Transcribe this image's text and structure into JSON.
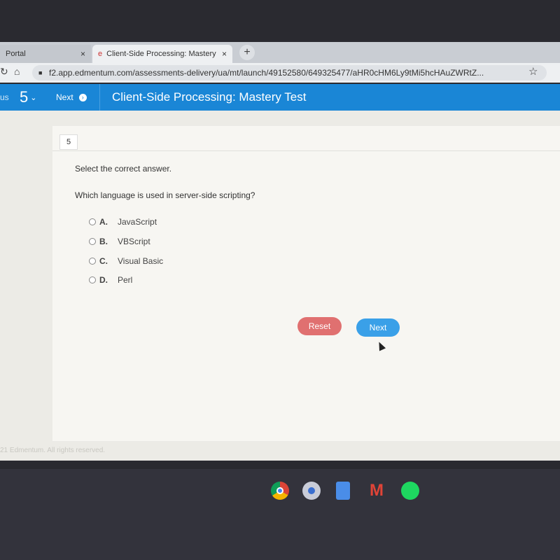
{
  "browser": {
    "tabs": [
      {
        "label": "Portal",
        "close": "×"
      },
      {
        "label": "Client-Side Processing: Mastery",
        "close": "×"
      }
    ],
    "new_tab": "+",
    "url": "f2.app.edmentum.com/assessments-delivery/ua/mt/launch/49152580/649325477/aHR0cHM6Ly9tMi5hcHAuZWRtZ...",
    "star": "☆"
  },
  "header": {
    "left_cut": "us",
    "question_selector": "5",
    "next_label": "Next",
    "title": "Client-Side Processing: Mastery Test",
    "color": "#1a86d6"
  },
  "question": {
    "number": "5",
    "instruction": "Select the correct answer.",
    "prompt": "Which language is used in server-side scripting?",
    "options": [
      {
        "letter": "A.",
        "text": "JavaScript"
      },
      {
        "letter": "B.",
        "text": "VBScript"
      },
      {
        "letter": "C.",
        "text": "Visual Basic"
      },
      {
        "letter": "D.",
        "text": "Perl"
      }
    ]
  },
  "buttons": {
    "reset": "Reset",
    "next": "Next",
    "reset_color": "#e07070",
    "next_color": "#3aa0e8"
  },
  "footer": "21 Edmentum. All rights reserved.",
  "shelf_icons": [
    "chrome-icon",
    "camera-icon",
    "docs-icon",
    "gmail-icon",
    "spotify-icon"
  ]
}
